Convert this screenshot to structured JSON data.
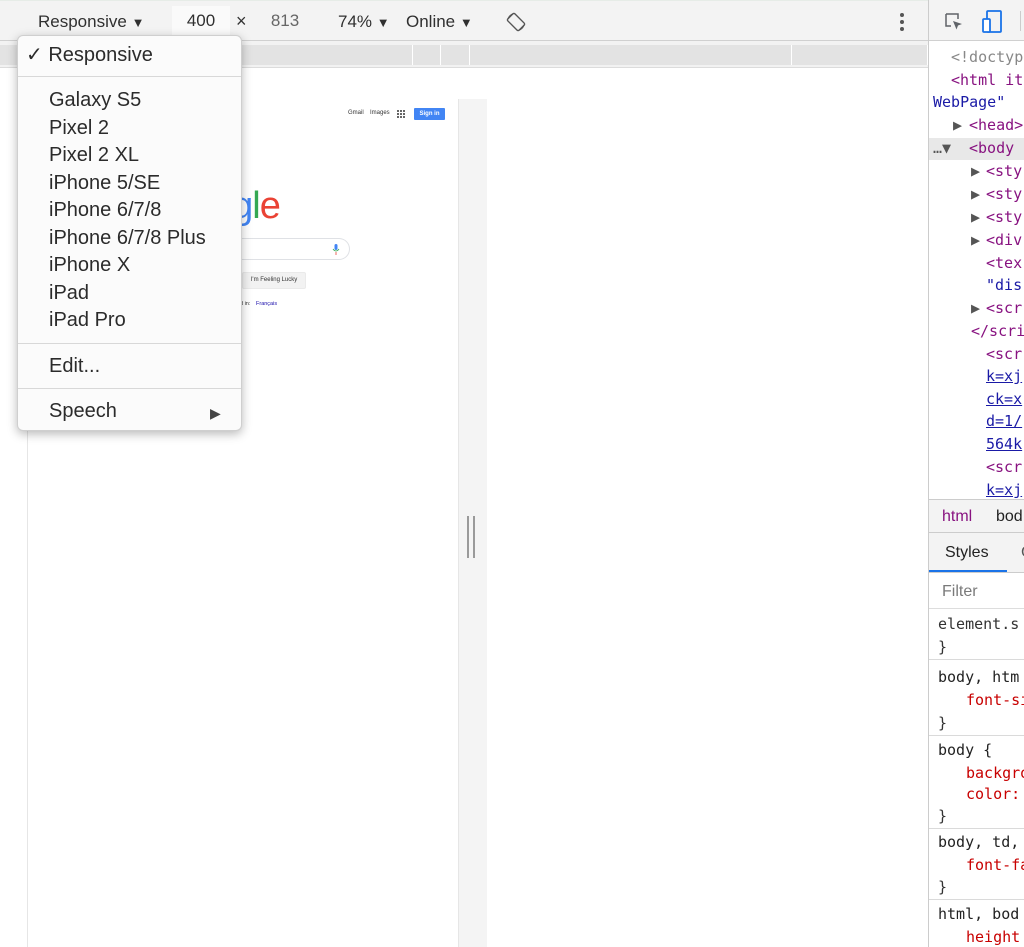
{
  "toolbar": {
    "device": "Responsive",
    "width": "400",
    "dims_separator": "×",
    "height": "813",
    "zoom": "74%",
    "throttle": "Online",
    "arrow": "▼",
    "rotate_icon": "rotate-icon",
    "more_icon": "more-vertical-icon"
  },
  "device_menu": {
    "check": "✓",
    "selected": "Responsive",
    "devices": [
      "Galaxy S5",
      "Pixel 2",
      "Pixel 2 XL",
      "iPhone 5/SE",
      "iPhone 6/7/8",
      "iPhone 6/7/8 Plus",
      "iPhone X",
      "iPad",
      "iPad Pro"
    ],
    "edit": "Edit...",
    "speech": "Speech",
    "submenu_arrow": "▶"
  },
  "preview": {
    "gmail": "Gmail",
    "images": "Images",
    "sign_in": "Sign in",
    "logo_partial": "ogle",
    "lucky": "I'm Feeling Lucky",
    "offered_in": "d in:",
    "language": "Français"
  },
  "devtools": {
    "elements_lines": [
      "<!doctyp",
      "<html it",
      "WebPage\"",
      "<head>",
      "<body",
      "<sty",
      "<sty",
      "<sty",
      "<div",
      "<tex",
      "\"dis",
      "<scr",
      "</scri",
      "<scr",
      "k=xj",
      "ck=x",
      "d=1/",
      "564k",
      "<scr",
      "k=xj"
    ],
    "breadcrumb_html": "html",
    "breadcrumb_body": "bod",
    "tab_styles": "Styles",
    "tab_computed": "C",
    "filter_placeholder": "Filter",
    "rules": [
      "element.s",
      "}",
      "body, htm",
      "font-si",
      "}",
      "body {",
      "backgro",
      "color:",
      "}",
      "body, td,",
      "font-fa",
      "}",
      "html, bod",
      "height"
    ]
  },
  "colors": {
    "accent": "#4285f4",
    "tab_underline": "#1a73e8"
  }
}
